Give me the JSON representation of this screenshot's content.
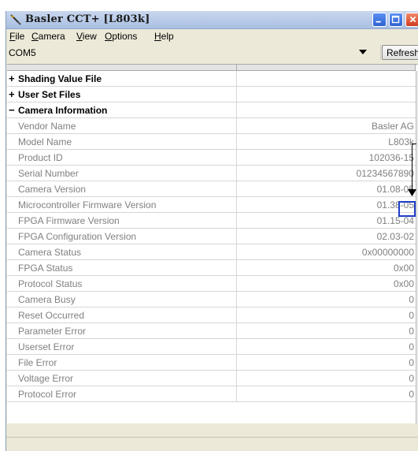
{
  "window": {
    "title": "Basler CCT+ [L803k]"
  },
  "menu": [
    {
      "label": "File",
      "key": "F"
    },
    {
      "label": "Camera",
      "key": "C"
    },
    {
      "label": "View",
      "key": "V"
    },
    {
      "label": "Options",
      "key": "O"
    },
    {
      "label": "Help",
      "key": "H"
    }
  ],
  "port": {
    "selected": "COM5",
    "refresh_label": "Refresh"
  },
  "tree": {
    "groups": [
      {
        "sign": "+",
        "label": "Shading Value File"
      },
      {
        "sign": "+",
        "label": "User Set Files"
      },
      {
        "sign": "−",
        "label": "Camera Information"
      }
    ],
    "properties": [
      {
        "label": "Vendor Name",
        "value": "Basler AG"
      },
      {
        "label": "Model Name",
        "value": "L803k"
      },
      {
        "label": "Product ID",
        "value": "102036-15"
      },
      {
        "label": "Serial Number",
        "value": "01234567890"
      },
      {
        "label": "Camera Version",
        "value": "01.08-05"
      },
      {
        "label": "Microcontroller Firmware Version",
        "value": "01.38-05"
      },
      {
        "label": "FPGA Firmware Version",
        "value": "01.15-04"
      },
      {
        "label": "FPGA Configuration Version",
        "value": "02.03-02"
      },
      {
        "label": "Camera Status",
        "value": "0x00000000"
      },
      {
        "label": "FPGA Status",
        "value": "0x00"
      },
      {
        "label": "Protocol Status",
        "value": "0x00"
      },
      {
        "label": "Camera Busy",
        "value": "0"
      },
      {
        "label": "Reset Occurred",
        "value": "0"
      },
      {
        "label": "Parameter Error",
        "value": "0"
      },
      {
        "label": "Userset Error",
        "value": "0"
      },
      {
        "label": "File Error",
        "value": "0"
      },
      {
        "label": "Voltage Error",
        "value": "0"
      },
      {
        "label": "Protocol Error",
        "value": "0"
      }
    ]
  },
  "colors": {
    "highlight": "#1f3dc8",
    "property_text": "#808080"
  }
}
